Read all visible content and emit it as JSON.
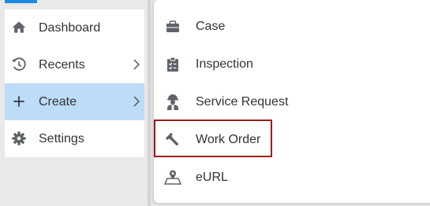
{
  "colors": {
    "accent": "#1e88e5",
    "active_bg": "#bcdcf8",
    "highlight_border": "#a01a1a",
    "icon_gray": "#5f6368"
  },
  "sidebar": {
    "items": [
      {
        "label": "Dashboard",
        "icon": "home-icon",
        "has_submenu": false
      },
      {
        "label": "Recents",
        "icon": "history-icon",
        "has_submenu": true
      },
      {
        "label": "Create",
        "icon": "plus-icon",
        "has_submenu": true,
        "active": true
      },
      {
        "label": "Settings",
        "icon": "gear-icon",
        "has_submenu": false
      }
    ]
  },
  "submenu": {
    "items": [
      {
        "label": "Case",
        "icon": "briefcase-icon"
      },
      {
        "label": "Inspection",
        "icon": "clipboard-icon"
      },
      {
        "label": "Service Request",
        "icon": "worker-icon"
      },
      {
        "label": "Work Order",
        "icon": "wrench-icon",
        "highlighted": true
      },
      {
        "label": "eURL",
        "icon": "map-pin-icon"
      }
    ]
  }
}
